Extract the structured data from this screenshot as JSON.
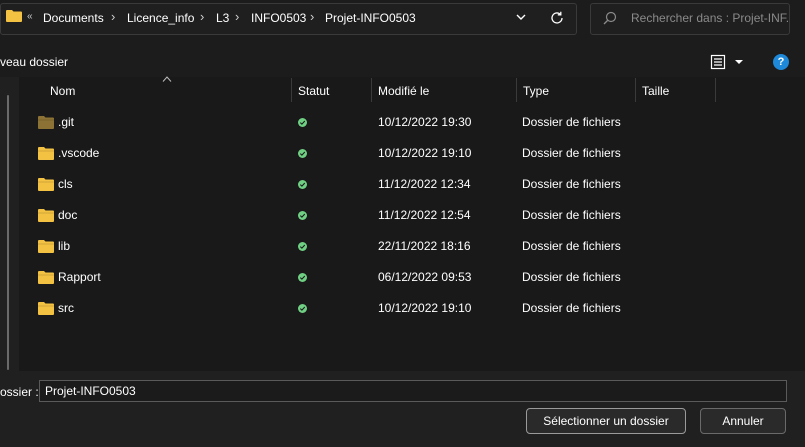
{
  "address": {
    "more": "«",
    "breadcrumbs": [
      "Documents",
      "Licence_info",
      "L3",
      "INFO0503",
      "Projet-INFO0503"
    ],
    "separator": "›",
    "search_placeholder": "Rechercher dans : Projet-INF..."
  },
  "toolbar": {
    "new_folder_label": "veau dossier",
    "help_label": "?"
  },
  "columns": {
    "name": "Nom",
    "status": "Statut",
    "modified": "Modifié le",
    "type": "Type",
    "size": "Taille"
  },
  "files": [
    {
      "name": ".git",
      "modified": "10/12/2022 19:30",
      "type": "Dossier de fichiers",
      "size": "",
      "dim": true
    },
    {
      "name": ".vscode",
      "modified": "10/12/2022 19:10",
      "type": "Dossier de fichiers",
      "size": ""
    },
    {
      "name": "cls",
      "modified": "11/12/2022 12:34",
      "type": "Dossier de fichiers",
      "size": ""
    },
    {
      "name": "doc",
      "modified": "11/12/2022 12:54",
      "type": "Dossier de fichiers",
      "size": ""
    },
    {
      "name": "lib",
      "modified": "22/11/2022 18:16",
      "type": "Dossier de fichiers",
      "size": ""
    },
    {
      "name": "Rapport",
      "modified": "06/12/2022 09:53",
      "type": "Dossier de fichiers",
      "size": ""
    },
    {
      "name": "src",
      "modified": "10/12/2022 19:10",
      "type": "Dossier de fichiers",
      "size": ""
    }
  ],
  "bottom": {
    "folder_label": "ossier :",
    "folder_value": "Projet-INFO0503",
    "select_button": "Sélectionner un dossier",
    "cancel_button": "Annuler"
  },
  "colors": {
    "folder": "#f4c242",
    "folder_dim": "#8c7234",
    "status_ok": "#6fcf82",
    "accent": "#1e88d9"
  }
}
